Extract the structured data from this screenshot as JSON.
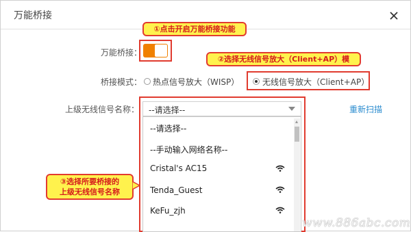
{
  "dialog": {
    "title": "万能桥接",
    "close_icon": "close-icon"
  },
  "bridge": {
    "label": "万能桥接：",
    "toggle_on": true
  },
  "mode": {
    "label": "桥接模式：",
    "options": [
      {
        "label": "热点信号放大（WISP）",
        "selected": false
      },
      {
        "label": "无线信号放大（Client+AP）",
        "selected": true
      }
    ]
  },
  "upstream": {
    "label": "上级无线信号名称：",
    "select_value": "--请选择--",
    "rescan": "重新扫描",
    "dropdown_items": [
      {
        "label": "--请选择--",
        "wifi": false
      },
      {
        "label": "--手动输入网络名称--",
        "wifi": false
      },
      {
        "label": "Cristal's AC15",
        "wifi": true
      },
      {
        "label": "Tenda_Guest",
        "wifi": true
      },
      {
        "label": "KeFu_zjh",
        "wifi": true
      }
    ]
  },
  "annotations": {
    "step1": "①点击开启万能桥接功能",
    "step2": "②选择无线信号放大（Client+AP）模",
    "step3_line1": "③选择所要桥接的",
    "step3_line2": "上级无线信号名称"
  },
  "watermark": "www.886abc.com",
  "colors": {
    "accent_orange": "#f08000",
    "annotation_red": "#e03a2e",
    "callout_yellow": "#fff24d",
    "link_blue": "#2b8ccf"
  }
}
